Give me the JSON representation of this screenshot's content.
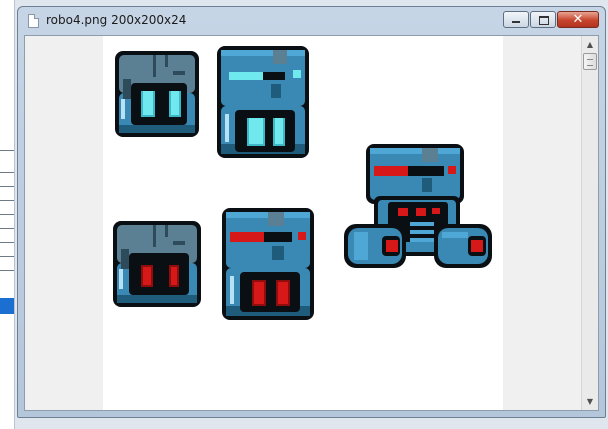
{
  "window": {
    "title": "robo4.png 200x200x24",
    "controls": {
      "minimize_icon": "minimize-icon",
      "maximize_icon": "maximize-icon",
      "close_icon": "close-icon",
      "close_glyph": "✕"
    }
  },
  "scrollbar": {
    "up_glyph": "▲",
    "down_glyph": "▼"
  },
  "sprites": [
    {
      "name": "robot-head-small-cyan",
      "eyes": "cyan"
    },
    {
      "name": "robot-head-tall-cyan",
      "eyes": "cyan"
    },
    {
      "name": "robot-head-small-red",
      "eyes": "red"
    },
    {
      "name": "robot-head-tall-red",
      "eyes": "red"
    },
    {
      "name": "robot-body-red",
      "eyes": "red"
    }
  ],
  "colors": {
    "outline": "#0a0f14",
    "metal_dark": "#1f5c7c",
    "metal": "#3a88b4",
    "metal_light": "#4fa7d6",
    "gray_top": "#5b7f93",
    "cyan": "#6fe8ee",
    "cyan_dark": "#3db8c6",
    "red": "#d61818",
    "red_dark": "#8e0d0d",
    "shine": "#b7e1f4"
  }
}
